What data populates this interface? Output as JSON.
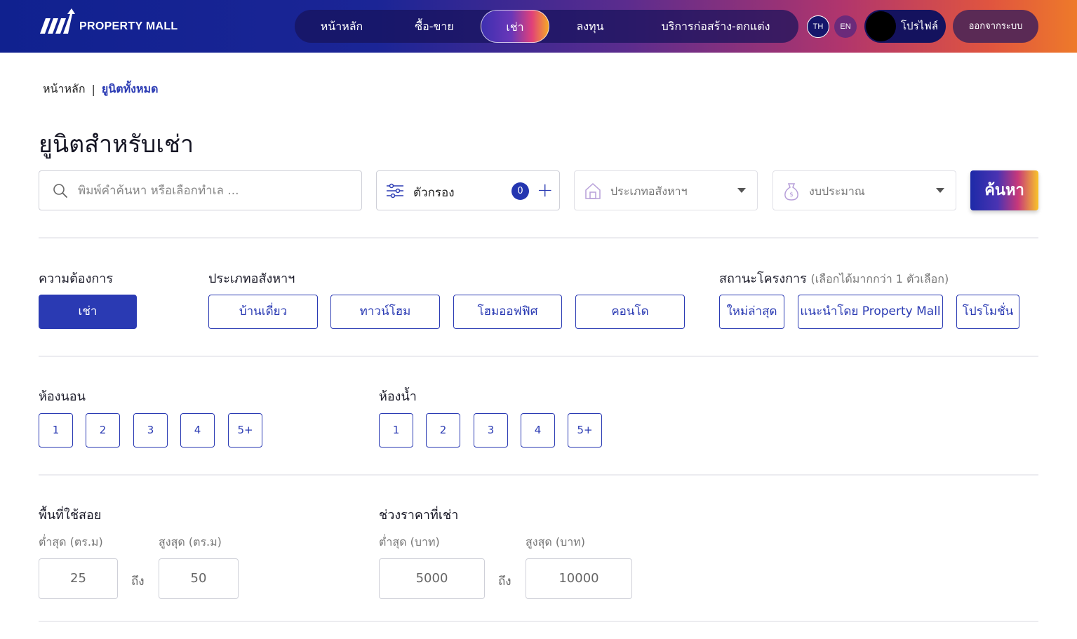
{
  "header": {
    "logo_text": "PROPERTY MALL",
    "nav": [
      {
        "label": "หน้าหลัก"
      },
      {
        "label": "ซื้อ-ขาย"
      },
      {
        "label": "เช่า"
      },
      {
        "label": "ลงทุน"
      },
      {
        "label": "บริการก่อสร้าง-ตกแต่ง"
      }
    ],
    "active_nav": "เช่า",
    "lang_th": "TH",
    "lang_en": "EN",
    "profile_label": "โปรไฟล์",
    "logout_label": "ออกจากระบบ"
  },
  "breadcrumb": {
    "home": "หน้าหลัก",
    "separator": "|",
    "current": "ยูนิตทั้งหมด"
  },
  "page_title": "ยูนิตสำหรับเช่า",
  "search": {
    "placeholder": "พิมพ์คำค้นหา หรือเลือกทำเล ...",
    "filter_label": "ตัวกรอง",
    "filter_count": "0",
    "filter_add": "+",
    "property_type_placeholder": "ประเภทอสังหาฯ",
    "budget_placeholder": "งบประมาณ",
    "search_button": "ค้นหา"
  },
  "filters": {
    "need": {
      "label": "ความต้องการ",
      "options": [
        "เช่า"
      ],
      "selected": "เช่า"
    },
    "property_type": {
      "label": "ประเภทอสังหาฯ",
      "options": [
        "บ้านเดี่ยว",
        "ทาวน์โฮม",
        "โฮมออฟฟิศ",
        "คอนโด"
      ]
    },
    "project_status": {
      "label": "สถานะโครงการ",
      "note": "(เลือกได้มากกว่า 1 ตัวเลือก)",
      "options": [
        "ใหม่ล่าสุด",
        "แนะนำโดย Property Mall",
        "โปรโมชั่น"
      ]
    },
    "bedrooms": {
      "label": "ห้องนอน",
      "options": [
        "1",
        "2",
        "3",
        "4",
        "5+"
      ]
    },
    "bathrooms": {
      "label": "ห้องน้ำ",
      "options": [
        "1",
        "2",
        "3",
        "4",
        "5+"
      ]
    },
    "area": {
      "label": "พื้นที่ใช้สอย",
      "min_label": "ต่ำสุด (ตร.ม)",
      "max_label": "สูงสุด (ตร.ม)",
      "min_value": "25",
      "max_value": "50",
      "to_label": "ถึง"
    },
    "price": {
      "label": "ช่วงราคาที่เช่า",
      "min_label": "ต่ำสุด (บาท)",
      "max_label": "สูงสุด (บาท)",
      "min_value": "5000",
      "max_value": "10000",
      "to_label": "ถึง"
    }
  },
  "colors": {
    "accent": "#2a3ab3",
    "header_start": "#10218f",
    "header_end": "#ee7a2a"
  }
}
